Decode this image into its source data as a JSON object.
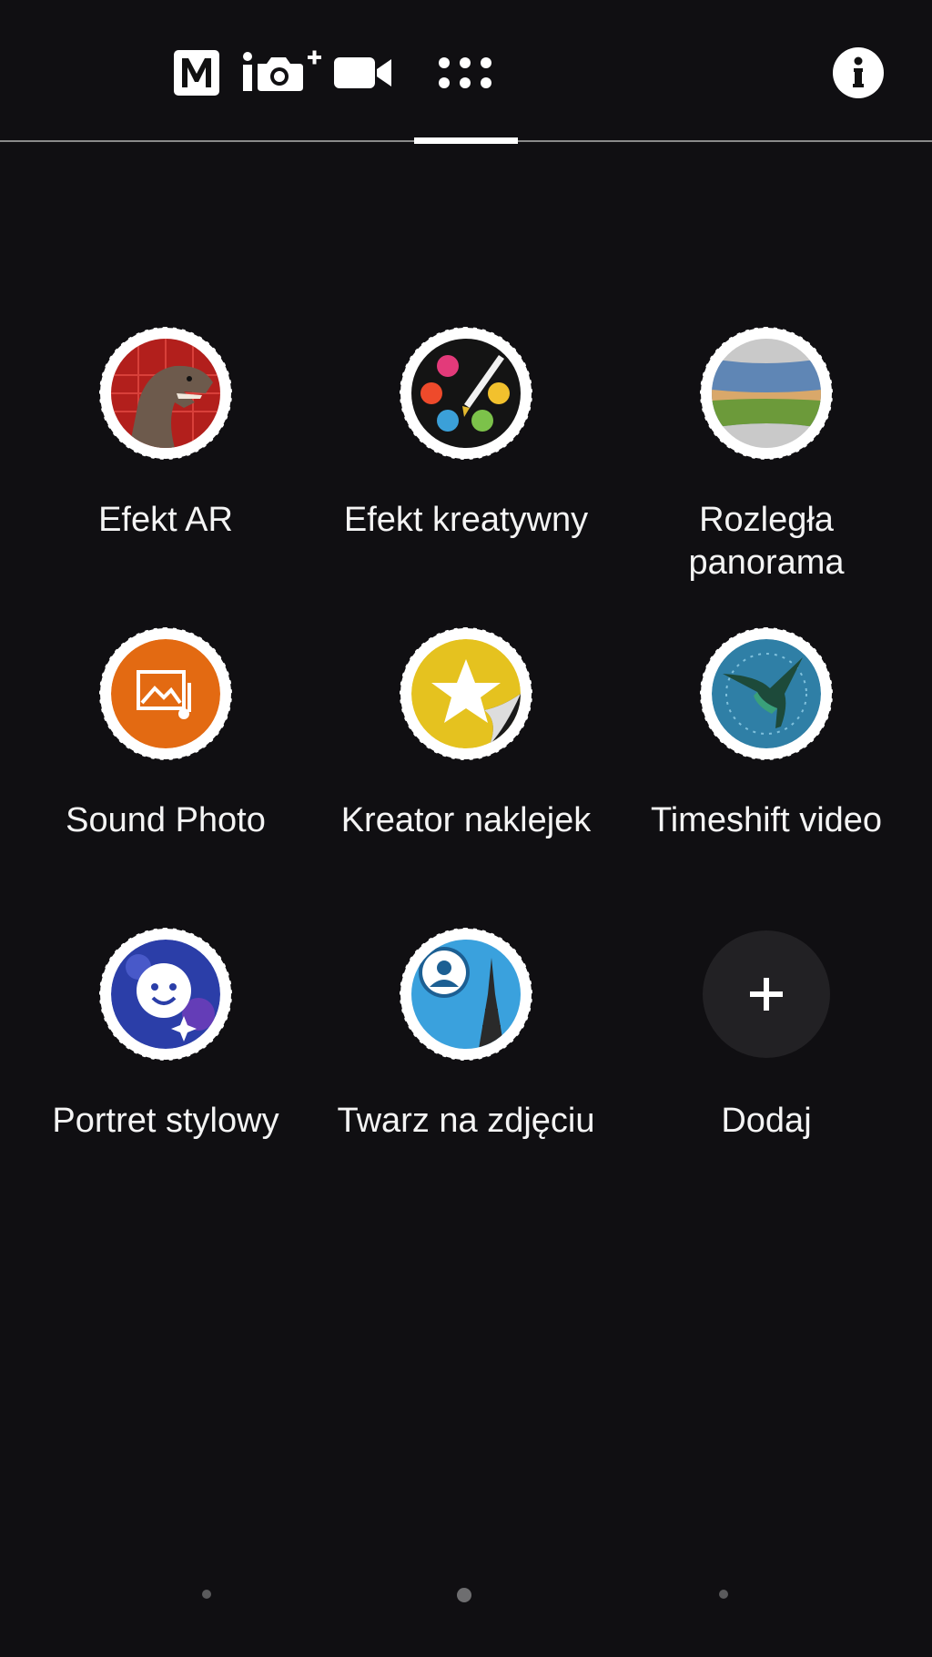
{
  "modes": [
    {
      "name": "manual-mode",
      "icon": "manual-m-icon"
    },
    {
      "name": "superior-auto-mode",
      "icon": "camera-plus-icon"
    },
    {
      "name": "video-mode",
      "icon": "video-camera-icon"
    },
    {
      "name": "camera-apps-mode",
      "icon": "apps-grid-icon",
      "selected": true
    }
  ],
  "info": {
    "icon": "info-icon"
  },
  "apps": [
    {
      "label": "Efekt AR",
      "icon": "dinosaur-icon"
    },
    {
      "label": "Efekt kreatywny",
      "icon": "palette-icon"
    },
    {
      "label": "Rozległa\npanorama",
      "icon": "panorama-icon"
    },
    {
      "label": "Sound Photo",
      "icon": "sound-photo-icon"
    },
    {
      "label": "Kreator naklejek",
      "icon": "sticker-star-icon"
    },
    {
      "label": "Timeshift video",
      "icon": "hummingbird-icon"
    },
    {
      "label": "Portret stylowy",
      "icon": "style-portrait-icon"
    },
    {
      "label": "Twarz na zdjęciu",
      "icon": "face-in-picture-icon"
    },
    {
      "label": "Dodaj",
      "icon": "plus-icon"
    }
  ],
  "pager": {
    "pages": 3,
    "current": 2
  },
  "colors": {
    "background": "#100f12",
    "accent": "#ffffff",
    "add_circle": "#222124"
  }
}
